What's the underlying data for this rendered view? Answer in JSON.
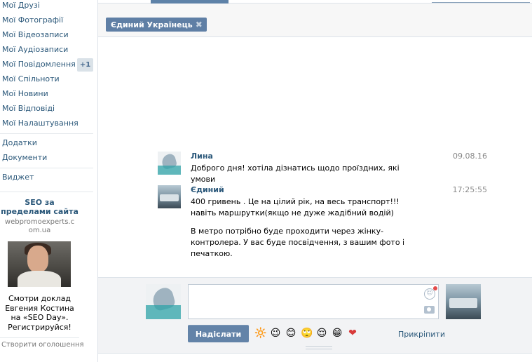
{
  "sidebar": {
    "items": [
      {
        "label": "Мої Друзі"
      },
      {
        "label": "Мої Фотографії"
      },
      {
        "label": "Мої Відеозаписи"
      },
      {
        "label": "Мої Аудіозаписи"
      },
      {
        "label": "Мої Повідомлення"
      },
      {
        "label": "Мої Спільноти"
      },
      {
        "label": "Мої Новини"
      },
      {
        "label": "Мої Відповіді"
      },
      {
        "label": "Мої Налаштування"
      }
    ],
    "messages_count": "+1",
    "extra": [
      {
        "label": "Додатки"
      },
      {
        "label": "Документи"
      }
    ],
    "widget": "Виджет",
    "ad": {
      "title": "SEO за пределами сайта",
      "domain": "webpromoexperts.com.ua",
      "text": "Смотри доклад Евгения Костина на «SEO Day». Регистрируйся!",
      "create": "Створити оголошення"
    }
  },
  "conversation": {
    "recipient_chip": "Єдиний Українець",
    "messages": [
      {
        "name": "Лина",
        "time": "09.08.16",
        "texts": [
          "Доброго дня! хотіла дізнатись щодо проїздних, які умови"
        ]
      },
      {
        "name": "Єдиний",
        "time": "17:25:55",
        "texts": [
          "400 гривень . Це на цілий рік, на весь транспорт!!! навіть маршрутки(якщо не дуже жадібний водій)",
          "В метро потрібно буде проходити через жінку-контролера. У вас буде посвідчення, з вашим фото і печаткою."
        ]
      }
    ]
  },
  "composer": {
    "send_label": "Надіслати",
    "attach_label": "Прикріпити",
    "emojis": [
      "🔆",
      "😉",
      "😊",
      "🙄",
      "😌",
      "😁",
      "❤"
    ],
    "icons": {
      "smile": "smile-icon",
      "camera": "camera-icon",
      "close": "close-icon"
    }
  }
}
